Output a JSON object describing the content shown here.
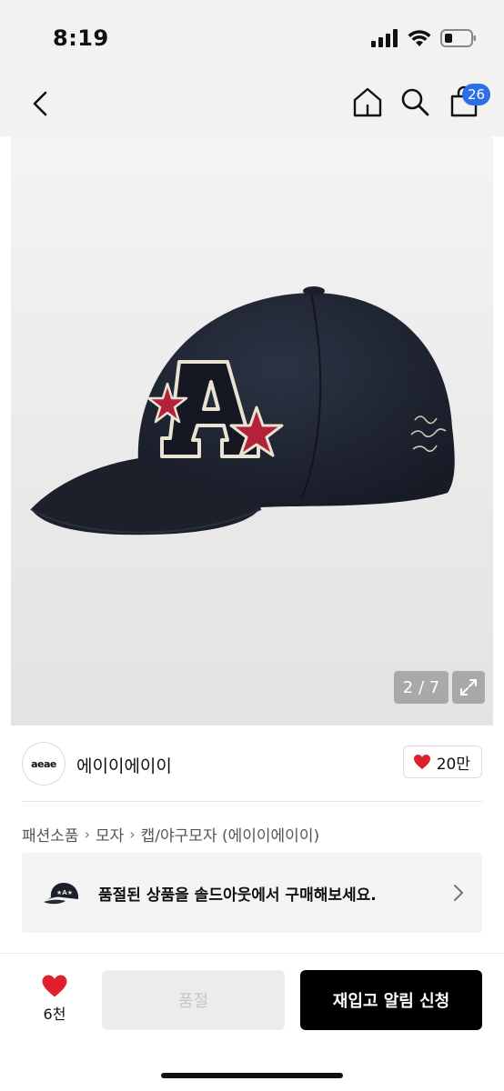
{
  "status_bar": {
    "time": "8:19"
  },
  "nav": {
    "cart_count": "26"
  },
  "gallery": {
    "counter": "2 / 7",
    "colors": {
      "cap": "#1f2432",
      "patch": "#151822",
      "star": "#b3223a",
      "outline": "#e9e3d3"
    }
  },
  "brand": {
    "logo_text": "aeae",
    "name": "에이이에이이",
    "likes": "20만"
  },
  "breadcrumb": {
    "items": [
      "패션소품",
      "모자",
      "캡/야구모자 (에이이에이이)"
    ]
  },
  "soldout_banner": {
    "text": "품절된 상품을 솔드아웃에서 구매해보세요."
  },
  "bottom": {
    "wish_count": "6천",
    "soldout_label": "품절",
    "restock_label": "재입고 알림 신청"
  },
  "colors": {
    "badge": "#2f6fe6",
    "heart": "#e0202c",
    "primary_button": "#000000"
  }
}
